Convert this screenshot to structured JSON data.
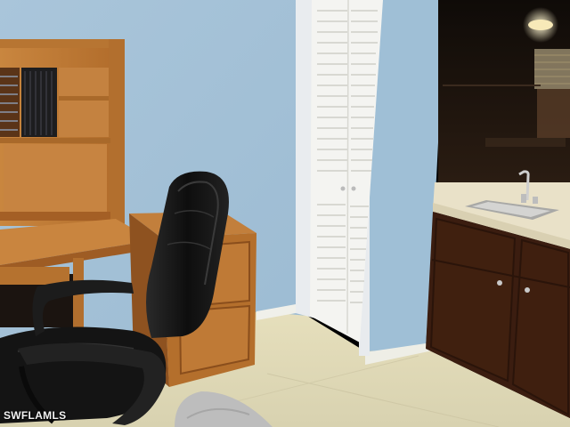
{
  "photo": {
    "watermark": "SWFLAMLS"
  },
  "colors": {
    "wall": "#a6c3d8",
    "wall_right": "#9fbfd7",
    "floor": "#e2dcb8",
    "wood": "#c07a34",
    "wood_dark": "#9a5a22",
    "cabinet": "#3a1c10",
    "chair": "#151515",
    "door": "#f3f3f0",
    "counter": "#e8e0c8",
    "mirror": "#1a120c"
  },
  "icons": {
    "sink-faucet": "faucet-icon"
  }
}
